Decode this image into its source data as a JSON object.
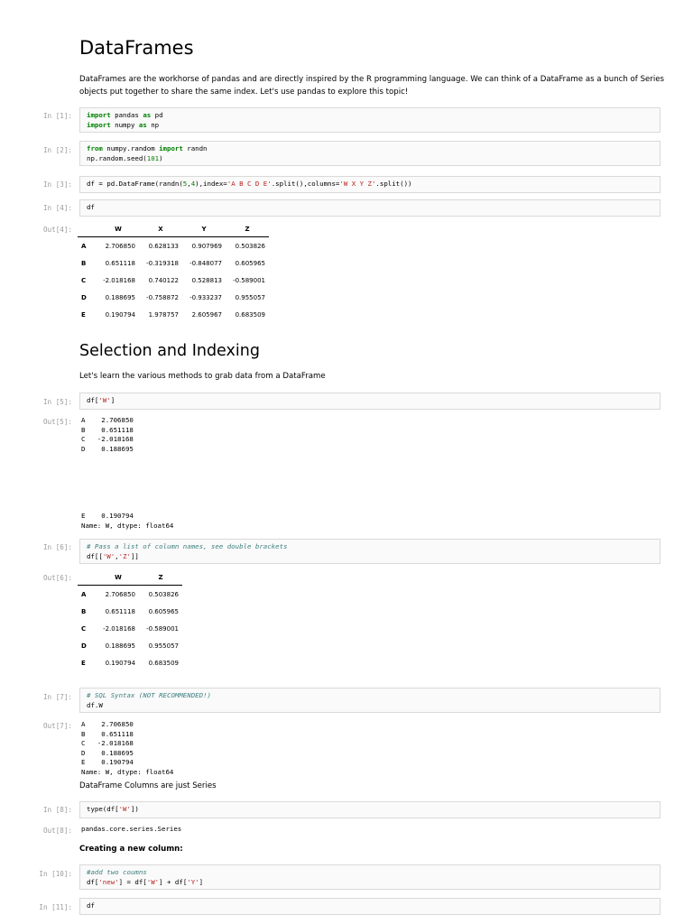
{
  "heading": "DataFrames",
  "intro_line1": "DataFrames are the workhorse of pandas and are directly inspired by the R programming language. We can think of a DataFrame as a bunch of Series",
  "intro_line2": "objects put together to share the same index. Let's use pandas to explore this topic!",
  "in1": "In [1]:",
  "in2": "In [2]:",
  "in3": "In [3]:",
  "in4": "In [4]:",
  "out4": "Out[4]:",
  "cell4_code": "df",
  "df_columns": [
    "W",
    "X",
    "Y",
    "Z"
  ],
  "df_rows": [
    {
      "idx": "A",
      "vals": [
        "2.706850",
        "0.628133",
        "0.907969",
        "0.503826"
      ]
    },
    {
      "idx": "B",
      "vals": [
        "0.651118",
        "-0.319318",
        "-0.848077",
        "0.605965"
      ]
    },
    {
      "idx": "C",
      "vals": [
        "-2.018168",
        "0.740122",
        "0.528813",
        "-0.589001"
      ]
    },
    {
      "idx": "D",
      "vals": [
        "0.188695",
        "-0.758872",
        "-0.933237",
        "0.955057"
      ]
    },
    {
      "idx": "E",
      "vals": [
        "0.190794",
        "1.978757",
        "2.605967",
        "0.683509"
      ]
    }
  ],
  "heading2": "Selection and Indexing",
  "sel_para": "Let's learn the various methods to grab data from a DataFrame",
  "in5": "In [5]:",
  "out5": "Out[5]:",
  "out5_lines": [
    "A    2.706850",
    "B    0.651118",
    "C   -2.018168",
    "D    0.188695"
  ],
  "out5_tail": [
    "E    0.190794",
    "Name: W, dtype: float64"
  ],
  "in6": "In [6]:",
  "cell6_comment": "# Pass a list of column names, see double brackets",
  "out6": "Out[6]:",
  "df2_columns": [
    "W",
    "Z"
  ],
  "df2_rows": [
    {
      "idx": "A",
      "vals": [
        "2.706850",
        "0.503826"
      ]
    },
    {
      "idx": "B",
      "vals": [
        "0.651118",
        "0.605965"
      ]
    },
    {
      "idx": "C",
      "vals": [
        "-2.018168",
        "-0.589001"
      ]
    },
    {
      "idx": "D",
      "vals": [
        "0.188695",
        "0.955057"
      ]
    },
    {
      "idx": "E",
      "vals": [
        "0.190794",
        "0.683509"
      ]
    }
  ],
  "in7": "In [7]:",
  "cell7_comment": "# SQL Syntax (NOT RECOMMENDED!)",
  "cell7_code": "df.W",
  "out7": "Out[7]:",
  "out7_lines": [
    "A    2.706850",
    "B    0.651118",
    "C   -2.018168",
    "D    0.188695",
    "E    0.190794",
    "Name: W, dtype: float64"
  ],
  "series_para": "DataFrame Columns are just Series",
  "in8": "In [8]:",
  "out8": "Out[8]:",
  "out8_text": "pandas.core.series.Series",
  "new_col_heading": "Creating a new column:",
  "in10": "In [10]:",
  "cell10_comment": "#add two coumns",
  "in11": "In [11]:",
  "cell11_code": "df"
}
